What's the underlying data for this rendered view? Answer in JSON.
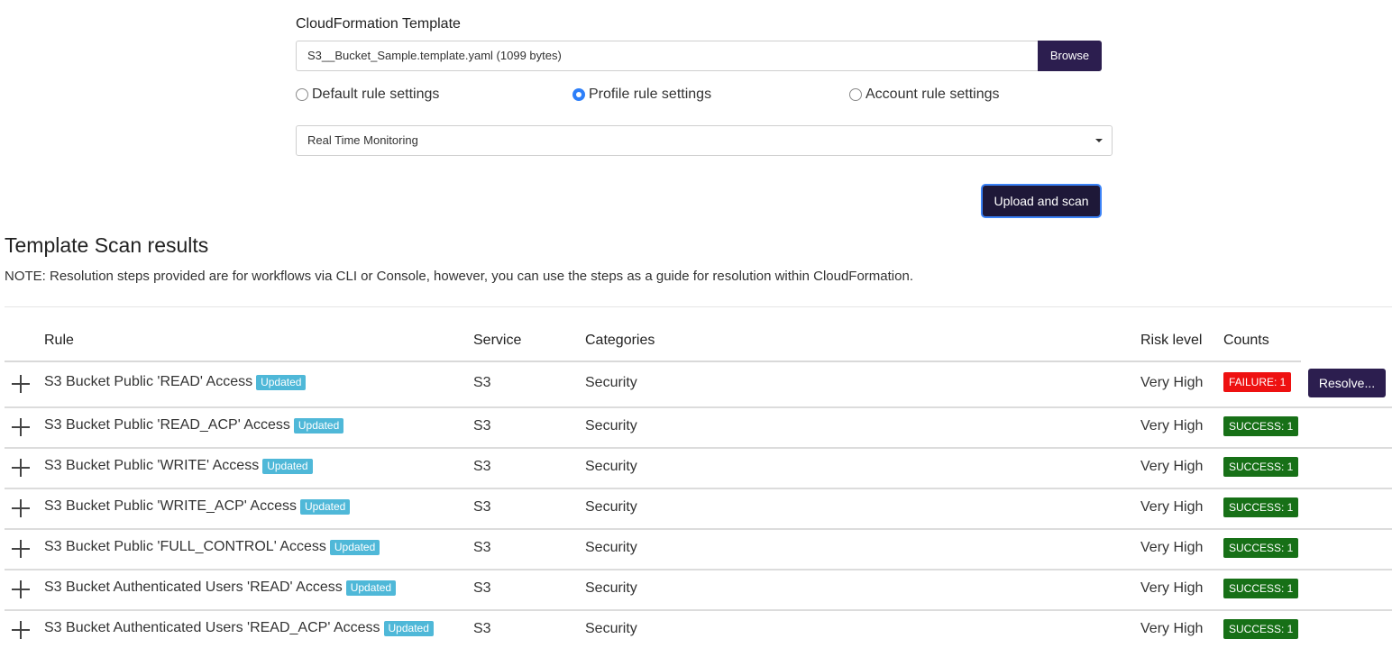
{
  "form": {
    "label": "CloudFormation Template",
    "file_value": "S3__Bucket_Sample.template.yaml (1099 bytes)",
    "browse_label": "Browse",
    "radio_options": [
      {
        "label": "Default rule settings",
        "checked": false
      },
      {
        "label": "Profile rule settings",
        "checked": true
      },
      {
        "label": "Account rule settings",
        "checked": false
      }
    ],
    "select_value": "Real Time Monitoring",
    "upload_label": "Upload and scan"
  },
  "results": {
    "title": "Template Scan results",
    "note": "NOTE: Resolution steps provided are for workflows via CLI or Console, however, you can use the steps as a guide for resolution within CloudFormation.",
    "columns": [
      "Rule",
      "Service",
      "Categories",
      "Risk level",
      "Counts"
    ],
    "rows": [
      {
        "rule": "S3 Bucket Public 'READ' Access",
        "badge": "Updated",
        "service": "S3",
        "category": "Security",
        "risk": "Very High",
        "count": "FAILURE: 1",
        "status": "failure",
        "action": "Resolve..."
      },
      {
        "rule": "S3 Bucket Public 'READ_ACP' Access",
        "badge": "Updated",
        "service": "S3",
        "category": "Security",
        "risk": "Very High",
        "count": "SUCCESS: 1",
        "status": "success"
      },
      {
        "rule": "S3 Bucket Public 'WRITE' Access",
        "badge": "Updated",
        "service": "S3",
        "category": "Security",
        "risk": "Very High",
        "count": "SUCCESS: 1",
        "status": "success"
      },
      {
        "rule": "S3 Bucket Public 'WRITE_ACP' Access",
        "badge": "Updated",
        "service": "S3",
        "category": "Security",
        "risk": "Very High",
        "count": "SUCCESS: 1",
        "status": "success"
      },
      {
        "rule": "S3 Bucket Public 'FULL_CONTROL' Access",
        "badge": "Updated",
        "service": "S3",
        "category": "Security",
        "risk": "Very High",
        "count": "SUCCESS: 1",
        "status": "success"
      },
      {
        "rule": "S3 Bucket Authenticated Users 'READ' Access",
        "badge": "Updated",
        "service": "S3",
        "category": "Security",
        "risk": "Very High",
        "count": "SUCCESS: 1",
        "status": "success"
      },
      {
        "rule": "S3 Bucket Authenticated Users 'READ_ACP' Access",
        "badge": "Updated",
        "service": "S3",
        "category": "Security",
        "risk": "Very High",
        "count": "SUCCESS: 1",
        "status": "success"
      }
    ]
  },
  "colors": {
    "primary_button": "#2c1e4f",
    "failure": "#ee1111",
    "success": "#177017",
    "updated_badge": "#4fb8d8",
    "radio_checked": "#2d7ff9"
  }
}
